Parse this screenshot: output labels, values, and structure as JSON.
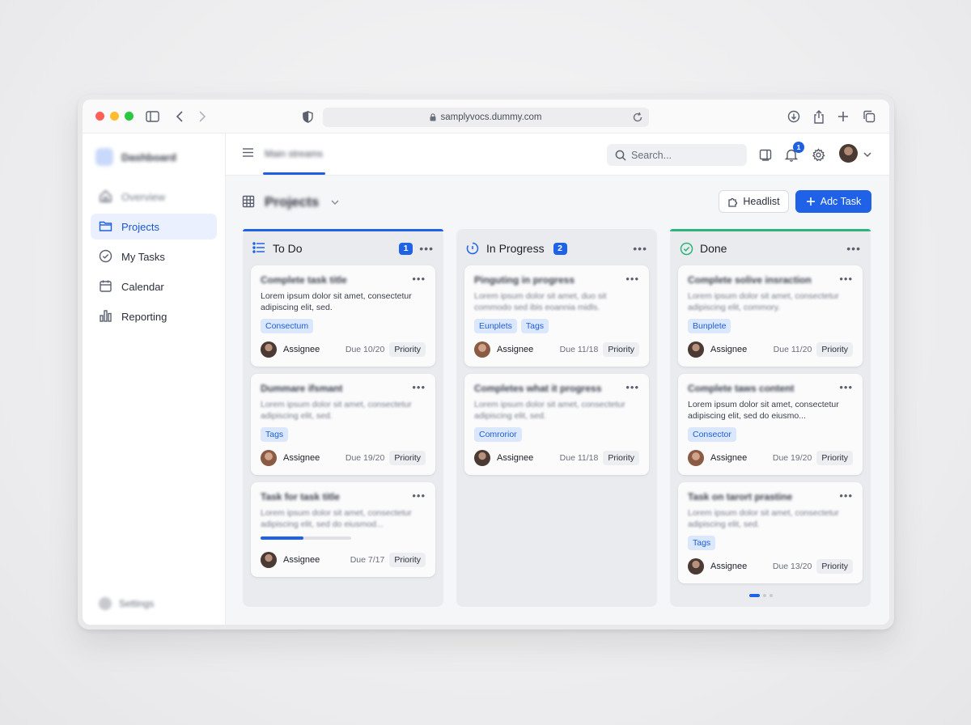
{
  "browser": {
    "url": "samplyvocs.dummy.com"
  },
  "sidebar": {
    "brand": "Dashboard",
    "items": [
      {
        "label": "Overview",
        "icon": "home-icon"
      },
      {
        "label": "Projects",
        "icon": "folder-icon",
        "active": true
      },
      {
        "label": "My Tasks",
        "icon": "check-circle-icon"
      },
      {
        "label": "Calendar",
        "icon": "calendar-icon"
      },
      {
        "label": "Reporting",
        "icon": "bar-chart-icon"
      }
    ],
    "settings": "Settings"
  },
  "topbar": {
    "tab": "Main streams",
    "search_placeholder": "Search...",
    "notification_count": "1"
  },
  "page": {
    "title": "Projects",
    "headlist_label": "Headlist",
    "add_task_label": "Adc Task"
  },
  "colors": {
    "accent": "#1f62e8",
    "done": "#2fb37a"
  },
  "columns": [
    {
      "title": "To Do",
      "count": "1",
      "cards": [
        {
          "title": "Complete task title",
          "desc": "Lorem ipsum dolor sit amet, consectetur adipiscing elit, sed.",
          "tags": [
            "Consectum"
          ],
          "assignee": "Assignee",
          "due": "Due 10/20",
          "priority": "Priority"
        },
        {
          "title": "Dummare ifsmant",
          "desc": "Lorem ipsum dolor sit amet, consectetur adipiscing elit, sed.",
          "tags": [
            "Tags"
          ],
          "assignee": "Assignee",
          "due": "Due 19/20",
          "priority": "Priority"
        },
        {
          "title": "Task for task title",
          "desc": "Lorem ipsum dolor sit amet, consectetur adipiscing elit, sed do eiusmod...",
          "progress": 0.47,
          "assignee": "Assignee",
          "due": "Due 7/17",
          "priority": "Priority"
        }
      ]
    },
    {
      "title": "In Progress",
      "count": "2",
      "cards": [
        {
          "title": "Pinguting in progress",
          "desc": "Lorem ipsum dolor sit amet, duo sit commodo sed ibis eoannia midls.",
          "tags": [
            "Eunplets",
            "Tags"
          ],
          "assignee": "Assignee",
          "due": "Due 11/18",
          "priority": "Priority"
        },
        {
          "title": "Completes what it progress",
          "desc": "Lorem ipsum dolor sit amet, consectetur adipiscing elit, sed.",
          "tags": [
            "Comrorior"
          ],
          "assignee": "Assignee",
          "due": "Due 11/18",
          "priority": "Priority"
        }
      ]
    },
    {
      "title": "Done",
      "cards": [
        {
          "title": "Complete solive insraction",
          "desc": "Lorem ipsum dolor sit amet, consectetur adipiscing elit, commory.",
          "tags": [
            "Bunplete"
          ],
          "assignee": "Assignee",
          "due": "Due 11/20",
          "priority": "Priority"
        },
        {
          "title": "Complete taws content",
          "desc": "Lorem ipsum dolor sit amet, consectetur adipiscing elit, sed do eiusmo...",
          "tags": [
            "Consector"
          ],
          "assignee": "Assignee",
          "due": "Due 19/20",
          "priority": "Priority"
        },
        {
          "title": "Task on tarort prastine",
          "desc": "Lorem ipsum dolor sit amet, consectetur adipiscing elit, sed.",
          "tags": [
            "Tags"
          ],
          "assignee": "Assignee",
          "due": "Due 13/20",
          "priority": "Priority"
        }
      ]
    }
  ]
}
